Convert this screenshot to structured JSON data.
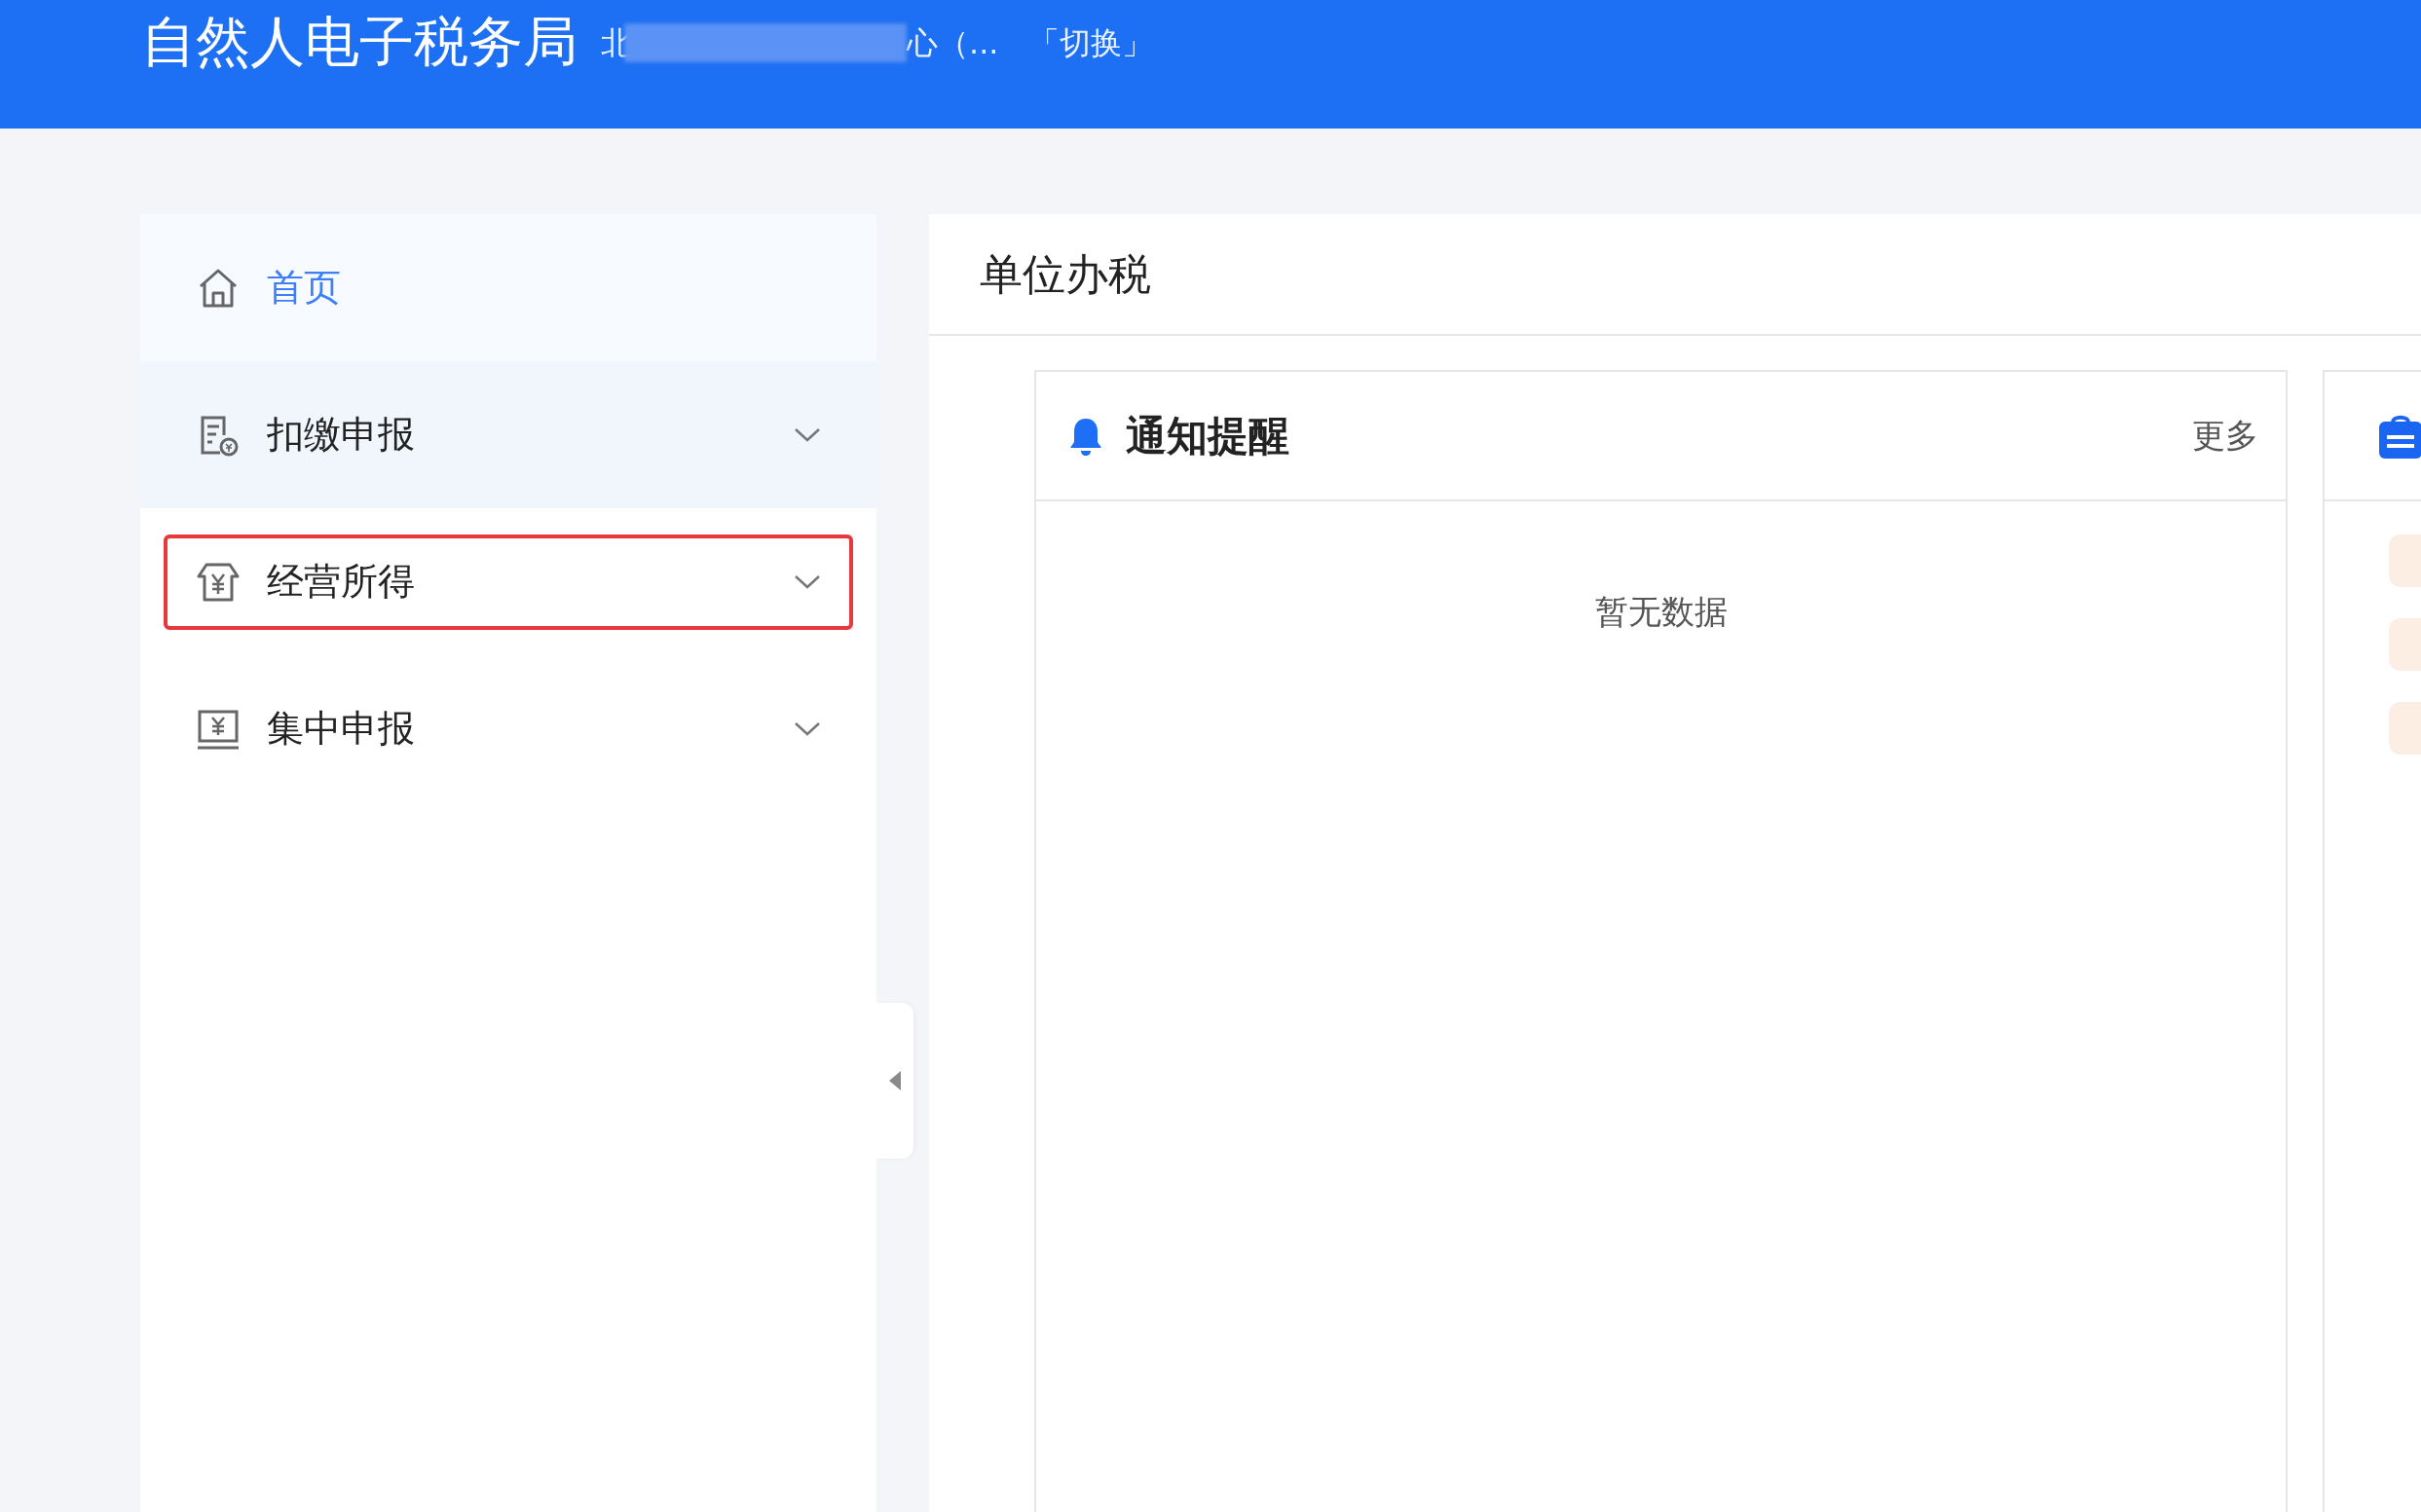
{
  "header": {
    "title": "自然人电子税务局",
    "unit_name_start": "北",
    "unit_name_end": "心（...",
    "switch_link": "「切换」"
  },
  "sidebar": {
    "items": [
      {
        "label": "首页",
        "selected": true,
        "hovered": false,
        "expandable": false,
        "highlighted": false
      },
      {
        "label": "扣缴申报",
        "selected": false,
        "hovered": true,
        "expandable": true,
        "highlighted": false
      },
      {
        "label": "经营所得",
        "selected": false,
        "hovered": false,
        "expandable": true,
        "highlighted": true
      },
      {
        "label": "集中申报",
        "selected": false,
        "hovered": false,
        "expandable": true,
        "highlighted": false
      }
    ]
  },
  "main": {
    "title": "单位办税",
    "notice_card": {
      "title": "通知提醒",
      "more": "更多",
      "empty_text": "暂无数据"
    }
  }
}
